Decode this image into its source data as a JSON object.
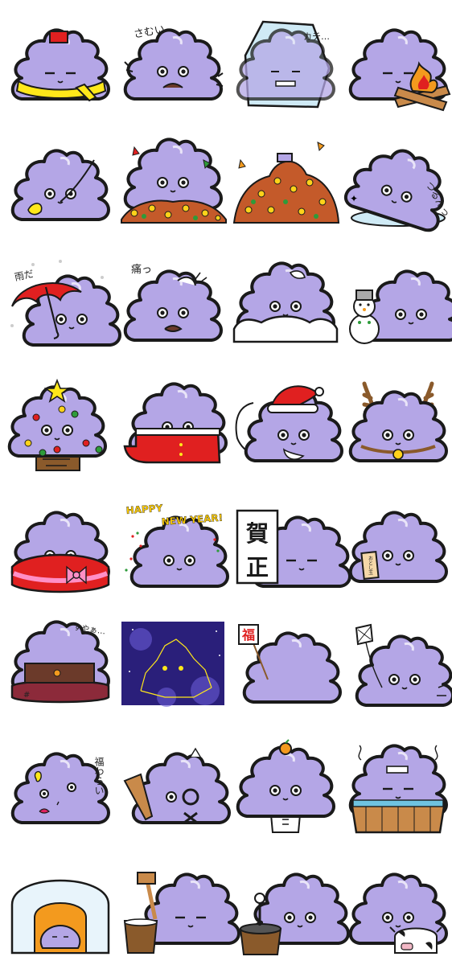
{
  "colors": {
    "blob": "#b4a6e6",
    "outline": "#1a1a1a",
    "red": "#e02020",
    "yellow": "#ffe81a",
    "orange": "#f39a1e",
    "brown": "#8a5a2b",
    "green": "#2e9b3a",
    "night": "#2a1f7a"
  },
  "stickers": [
    {
      "id": "scarf-hat"
    },
    {
      "id": "cold",
      "caption": "さむい"
    },
    {
      "id": "frozen",
      "caption": "カチ…"
    },
    {
      "id": "campfire"
    },
    {
      "id": "leaf-wind"
    },
    {
      "id": "leaf-pile-small"
    },
    {
      "id": "leaf-pile-big"
    },
    {
      "id": "slip",
      "caption": "つるんっ"
    },
    {
      "id": "umbrella",
      "caption": "雨だ"
    },
    {
      "id": "hurt",
      "caption": "痛っ"
    },
    {
      "id": "snow-bank"
    },
    {
      "id": "snowman"
    },
    {
      "id": "christmas-tree"
    },
    {
      "id": "santa-costume"
    },
    {
      "id": "santa-hat"
    },
    {
      "id": "reindeer"
    },
    {
      "id": "gift-wrap"
    },
    {
      "id": "happy-new-year",
      "caption_line1": "HAPPY",
      "caption_line2": "NEW YEAR!"
    },
    {
      "id": "greeting-sign",
      "sign_top": "賀",
      "sign_bottom": "正"
    },
    {
      "id": "envelope",
      "envelope_text": "おとし玉"
    },
    {
      "id": "kotatsu",
      "caption": "すやぁ…"
    },
    {
      "id": "constellation"
    },
    {
      "id": "lucky-charm",
      "tag": "福"
    },
    {
      "id": "kite"
    },
    {
      "id": "fukuwarai",
      "caption": "福わらい"
    },
    {
      "id": "hanetsuki"
    },
    {
      "id": "kagami-mochi"
    },
    {
      "id": "onsen"
    },
    {
      "id": "kamakura"
    },
    {
      "id": "mochi-pounding"
    },
    {
      "id": "tea-ceremony"
    },
    {
      "id": "cow"
    }
  ]
}
